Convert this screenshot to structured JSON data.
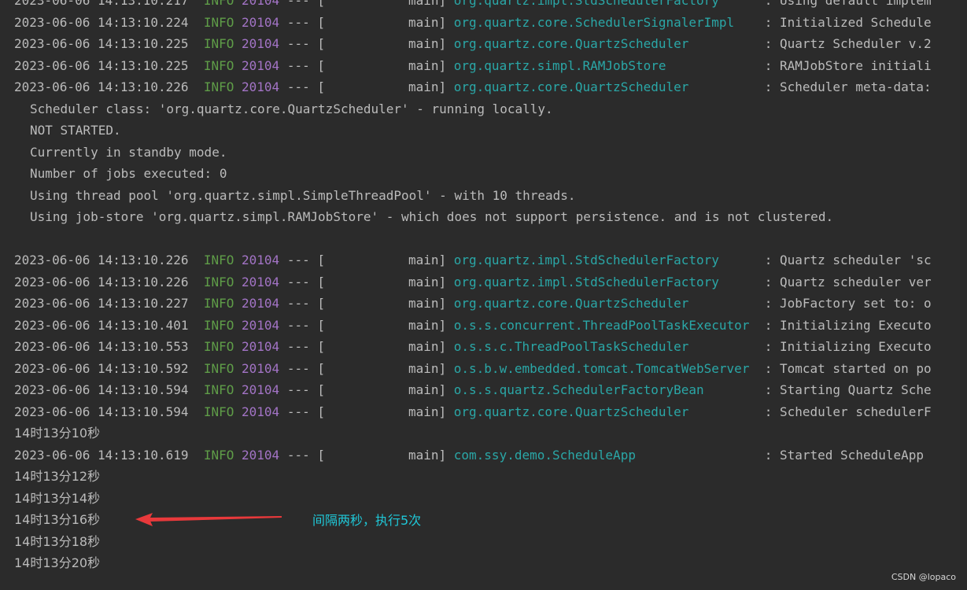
{
  "log_lines": [
    {
      "ts": "2023-06-06 14:13:10.217",
      "level": "INFO",
      "pid": "20104",
      "sep": "--- [",
      "thread": "main]",
      "logger": "org.quartz.impl.StdSchedulerFactory",
      "message": ": Using default implem"
    },
    {
      "ts": "2023-06-06 14:13:10.224",
      "level": "INFO",
      "pid": "20104",
      "sep": "--- [",
      "thread": "main]",
      "logger": "org.quartz.core.SchedulerSignalerImpl",
      "message": ": Initialized Schedule"
    },
    {
      "ts": "2023-06-06 14:13:10.225",
      "level": "INFO",
      "pid": "20104",
      "sep": "--- [",
      "thread": "main]",
      "logger": "org.quartz.core.QuartzScheduler",
      "message": ": Quartz Scheduler v.2"
    },
    {
      "ts": "2023-06-06 14:13:10.225",
      "level": "INFO",
      "pid": "20104",
      "sep": "--- [",
      "thread": "main]",
      "logger": "org.quartz.simpl.RAMJobStore",
      "message": ": RAMJobStore initiali"
    },
    {
      "ts": "2023-06-06 14:13:10.226",
      "level": "INFO",
      "pid": "20104",
      "sep": "--- [",
      "thread": "main]",
      "logger": "org.quartz.core.QuartzScheduler",
      "message": ": Scheduler meta-data:"
    }
  ],
  "metadata_lines": [
    "Scheduler class: 'org.quartz.core.QuartzScheduler' - running locally.",
    "NOT STARTED.",
    "Currently in standby mode.",
    "Number of jobs executed: 0",
    "Using thread pool 'org.quartz.simpl.SimpleThreadPool' - with 10 threads.",
    "Using job-store 'org.quartz.simpl.RAMJobStore' - which does not support persistence. and is not clustered."
  ],
  "log_lines_2": [
    {
      "ts": "2023-06-06 14:13:10.226",
      "level": "INFO",
      "pid": "20104",
      "sep": "--- [",
      "thread": "main]",
      "logger": "org.quartz.impl.StdSchedulerFactory",
      "message": ": Quartz scheduler 'sc"
    },
    {
      "ts": "2023-06-06 14:13:10.226",
      "level": "INFO",
      "pid": "20104",
      "sep": "--- [",
      "thread": "main]",
      "logger": "org.quartz.impl.StdSchedulerFactory",
      "message": ": Quartz scheduler ver"
    },
    {
      "ts": "2023-06-06 14:13:10.227",
      "level": "INFO",
      "pid": "20104",
      "sep": "--- [",
      "thread": "main]",
      "logger": "org.quartz.core.QuartzScheduler",
      "message": ": JobFactory set to: o"
    },
    {
      "ts": "2023-06-06 14:13:10.401",
      "level": "INFO",
      "pid": "20104",
      "sep": "--- [",
      "thread": "main]",
      "logger": "o.s.s.concurrent.ThreadPoolTaskExecutor",
      "message": ": Initializing Executo"
    },
    {
      "ts": "2023-06-06 14:13:10.553",
      "level": "INFO",
      "pid": "20104",
      "sep": "--- [",
      "thread": "main]",
      "logger": "o.s.s.c.ThreadPoolTaskScheduler",
      "message": ": Initializing Executo"
    },
    {
      "ts": "2023-06-06 14:13:10.592",
      "level": "INFO",
      "pid": "20104",
      "sep": "--- [",
      "thread": "main]",
      "logger": "o.s.b.w.embedded.tomcat.TomcatWebServer",
      "message": ": Tomcat started on po"
    },
    {
      "ts": "2023-06-06 14:13:10.594",
      "level": "INFO",
      "pid": "20104",
      "sep": "--- [",
      "thread": "main]",
      "logger": "o.s.s.quartz.SchedulerFactoryBean",
      "message": ": Starting Quartz Sche"
    },
    {
      "ts": "2023-06-06 14:13:10.594",
      "level": "INFO",
      "pid": "20104",
      "sep": "--- [",
      "thread": "main]",
      "logger": "org.quartz.core.QuartzScheduler",
      "message": ": Scheduler schedulerF"
    }
  ],
  "stdout_1": "14时13分10秒",
  "log_line_started": {
    "ts": "2023-06-06 14:13:10.619",
    "level": "INFO",
    "pid": "20104",
    "sep": "--- [",
    "thread": "main]",
    "logger": "com.ssy.demo.ScheduleApp",
    "message": ": Started ScheduleApp"
  },
  "stdout_rest": [
    "14时13分12秒",
    "14时13分14秒",
    "14时13分16秒",
    "14时13分18秒",
    "14时13分20秒"
  ],
  "annotation": {
    "text": "间隔两秒，执行5次",
    "color": "#1fc8d8",
    "arrow_color": "#e8393b"
  },
  "watermark": "CSDN @lopaco",
  "colors": {
    "background": "#2b2b2b",
    "info": "#5f9d48",
    "pid": "#a374c6",
    "logger": "#2aa7a7",
    "text": "#bbbbbb"
  }
}
